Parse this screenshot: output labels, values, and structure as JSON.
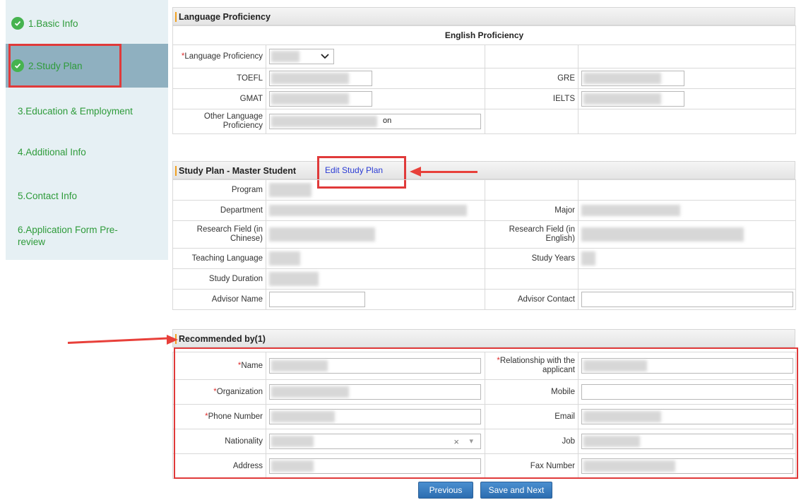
{
  "sidebar": {
    "steps": [
      {
        "label": "1.Basic Info"
      },
      {
        "label": "2.Study Plan"
      },
      {
        "label": "3.Education & Employment"
      },
      {
        "label": "4.Additional Info"
      },
      {
        "label": "5.Contact Info"
      },
      {
        "label": "6.Application Form Pre-review"
      }
    ]
  },
  "language": {
    "title": "Language Proficiency",
    "subheader": "English Proficiency",
    "lang_prof_label": "Language Proficiency",
    "toefl_label": "TOEFL",
    "gre_label": "GRE",
    "gmat_label": "GMAT",
    "ielts_label": "IELTS",
    "other_label": "Other Language Proficiency",
    "other_value_fragment": "on"
  },
  "study_plan": {
    "title": "Study Plan  - Master Student",
    "edit_link": "Edit Study Plan",
    "program_label": "Program",
    "department_label": "Department",
    "major_label": "Major",
    "research_cn_label": "Research Field (in Chinese)",
    "research_en_label": "Research Field (in English)",
    "teaching_lang_label": "Teaching Language",
    "study_years_label": "Study Years",
    "study_duration_label": "Study Duration",
    "advisor_name_label": "Advisor Name",
    "advisor_contact_label": "Advisor Contact"
  },
  "recommended": {
    "title": "Recommended by(1)",
    "name_label": "Name",
    "relationship_label": "Relationship with the applicant",
    "organization_label": "Organization",
    "mobile_label": "Mobile",
    "phone_label": "Phone Number",
    "email_label": "Email",
    "nationality_label": "Nationality",
    "job_label": "Job",
    "address_label": "Address",
    "fax_label": "Fax Number",
    "clear_glyph": "×",
    "dropdown_glyph": "▾"
  },
  "buttons": {
    "previous": "Previous",
    "save_next": "Save and Next"
  },
  "colors": {
    "sidebar_bg": "#e6f0f4",
    "active_step_bg": "#8fb0c0",
    "step_text": "#2e9b3a",
    "required_star": "#e03030",
    "annotation_red": "#e03a3a",
    "button_blue": "#2c6db0"
  },
  "icons": [
    "check-circle-icon",
    "chevron-down-icon",
    "clear-icon",
    "dropdown-caret-icon"
  ]
}
